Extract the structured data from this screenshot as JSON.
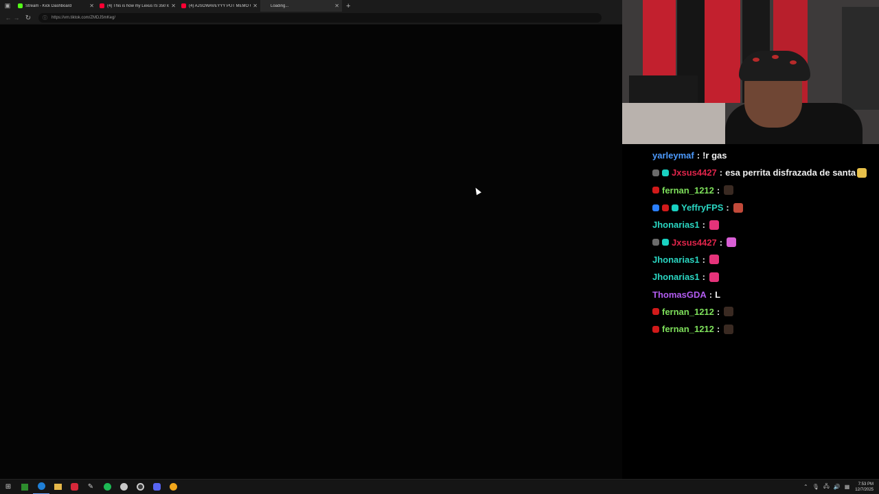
{
  "browser": {
    "tabs": [
      {
        "title": "Stream - Kick Dashboard",
        "favicon_color": "#53fc18"
      },
      {
        "title": "(4) This is how my Lexus IS 350 lo",
        "favicon_color": "#ff0033"
      },
      {
        "title": "(4) AJSOWAVEYYY PUT MEMO O",
        "favicon_color": "#ff0033"
      },
      {
        "title": "Loading...",
        "favicon_color": "#888888"
      }
    ],
    "url": "https://vm.tiktok.com/ZMDJ5mKeg/"
  },
  "chat": {
    "messages": [
      {
        "user": "yarleymaf",
        "color": "#4d9bff",
        "text": "!r gas",
        "badges": [],
        "emote": null
      },
      {
        "user": "Jxsus4427",
        "color": "#e0254b",
        "text": "esa perrita disfrazada de santa",
        "badges": [
          "#6b6b6b",
          "#19d1c1"
        ],
        "emote": "#e8c04a"
      },
      {
        "user": "fernan_1212",
        "color": "#7ee05b",
        "text": "",
        "badges": [
          "#d11a1a"
        ],
        "emote": "#3a2a22"
      },
      {
        "user": "YeffryFPS",
        "color": "#2ad6c2",
        "text": "",
        "badges": [
          "#2a7fff",
          "#d11a1a",
          "#19d1c1"
        ],
        "emote": "#c24a3a"
      },
      {
        "user": "Jhonarias1",
        "color": "#2ad6c2",
        "text": "",
        "badges": [],
        "emote": "#e5337a"
      },
      {
        "user": "Jxsus4427",
        "color": "#e0254b",
        "text": "",
        "badges": [
          "#6b6b6b",
          "#19d1c1"
        ],
        "emote": "#d95fd6"
      },
      {
        "user": "Jhonarias1",
        "color": "#2ad6c2",
        "text": "",
        "badges": [],
        "emote": "#e5337a"
      },
      {
        "user": "Jhonarias1",
        "color": "#2ad6c2",
        "text": "",
        "badges": [],
        "emote": "#e5337a"
      },
      {
        "user": "ThomasGDA",
        "color": "#b25cf0",
        "text": "L",
        "badges": [],
        "emote": null
      },
      {
        "user": "fernan_1212",
        "color": "#7ee05b",
        "text": "",
        "badges": [
          "#d11a1a"
        ],
        "emote": "#3a2a22"
      },
      {
        "user": "fernan_1212",
        "color": "#7ee05b",
        "text": "",
        "badges": [
          "#d11a1a"
        ],
        "emote": "#3a2a22"
      }
    ]
  },
  "taskbar": {
    "icons": [
      "start-icon",
      "terminal-icon",
      "edge-icon",
      "file-explorer-icon",
      "vivaldi-icon",
      "pen-icon",
      "spotify-icon",
      "steam-icon",
      "obs-icon",
      "discord-icon",
      "chrome-icon"
    ],
    "time": "7:53 PM",
    "date": "12/7/2025"
  }
}
